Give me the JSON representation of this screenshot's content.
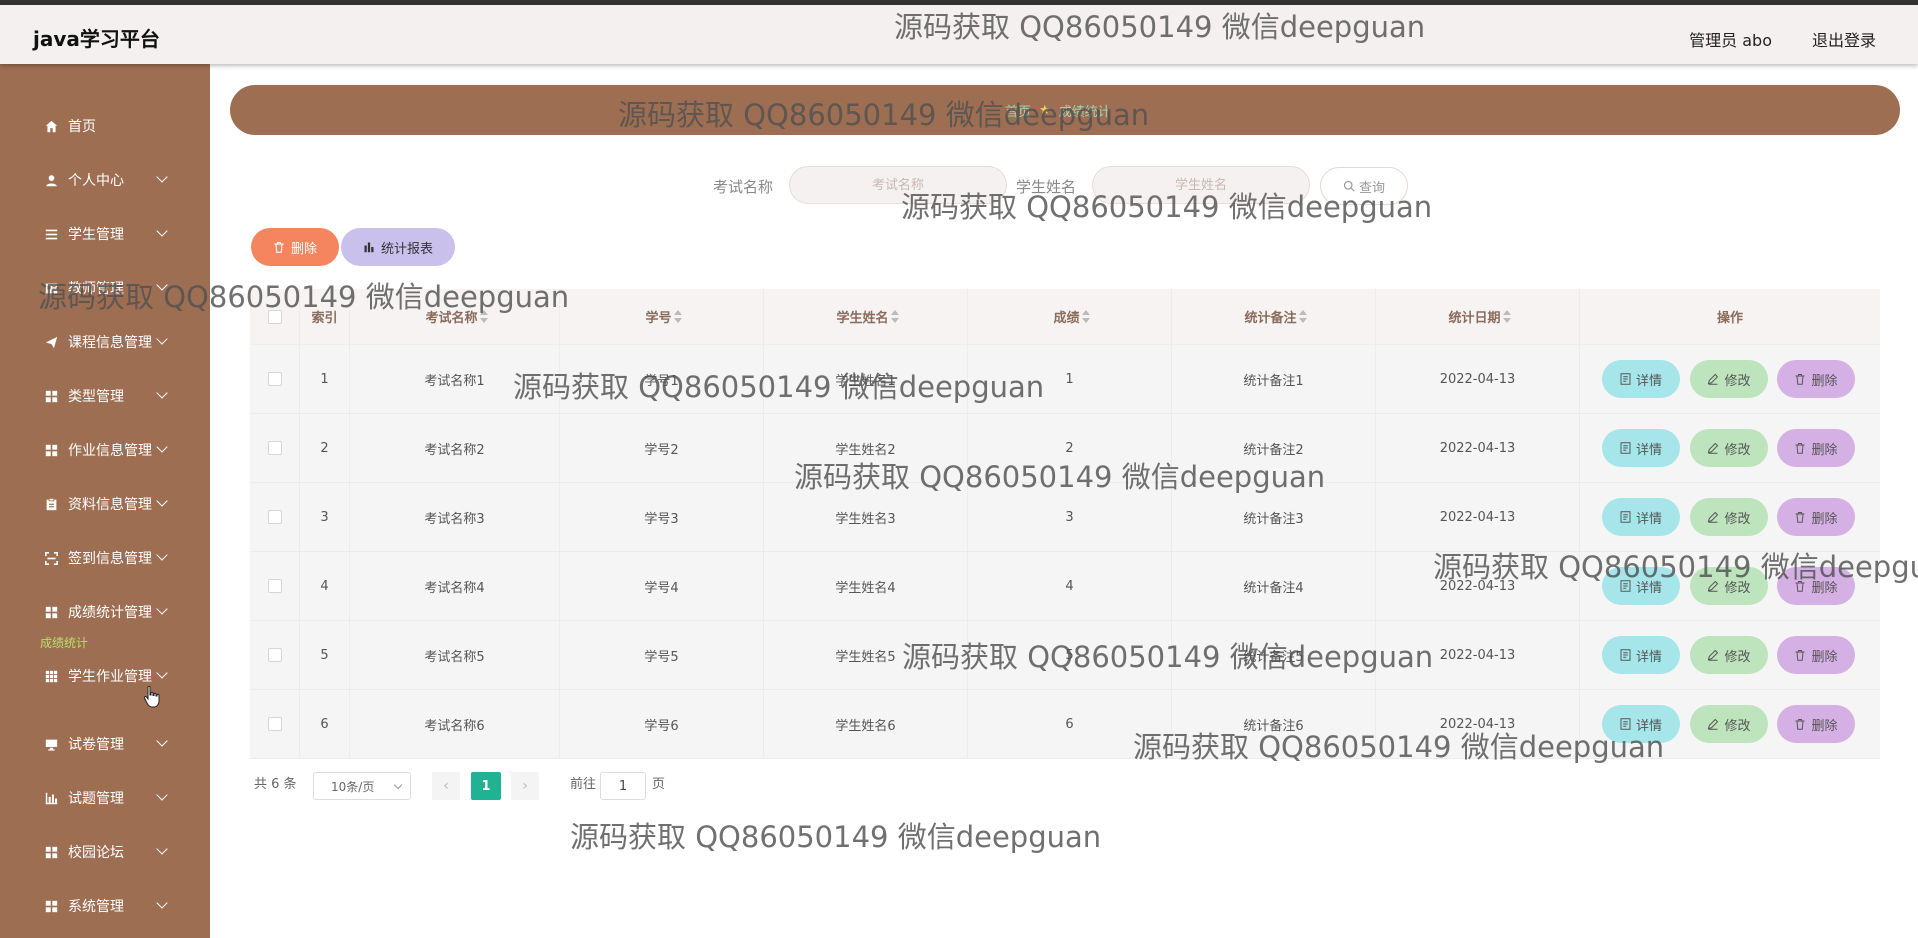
{
  "header": {
    "brand": "java学习平台",
    "user": "管理员 abo",
    "logout": "退出登录"
  },
  "sidebar": {
    "items": [
      {
        "label": "首页",
        "icon": "home-icon"
      },
      {
        "label": "个人中心",
        "icon": "user-icon"
      },
      {
        "label": "学生管理",
        "icon": "list-icon"
      },
      {
        "label": "教师管理",
        "icon": "id-card-icon"
      },
      {
        "label": "课程信息管理",
        "icon": "send-icon"
      },
      {
        "label": "类型管理",
        "icon": "grid-icon"
      },
      {
        "label": "作业信息管理",
        "icon": "grid-icon"
      },
      {
        "label": "资料信息管理",
        "icon": "clipboard-icon"
      },
      {
        "label": "签到信息管理",
        "icon": "scan-icon"
      },
      {
        "label": "成绩统计管理",
        "icon": "grid-icon"
      },
      {
        "label": "学生作业管理",
        "icon": "apps-icon"
      },
      {
        "label": "试卷管理",
        "icon": "monitor-icon"
      },
      {
        "label": "试题管理",
        "icon": "bar-chart-icon"
      },
      {
        "label": "校园论坛",
        "icon": "grid-icon"
      },
      {
        "label": "系统管理",
        "icon": "grid-icon"
      }
    ],
    "sub_label": "成绩统计"
  },
  "breadcrumb": {
    "home": "首页",
    "current": "成绩统计"
  },
  "search": {
    "exam_label": "考试名称",
    "exam_placeholder": "考试名称",
    "student_label": "学生姓名",
    "student_placeholder": "学生姓名",
    "query": "查询"
  },
  "toolbar": {
    "delete": "删除",
    "report": "统计报表"
  },
  "table": {
    "columns": [
      "索引",
      "考试名称",
      "学号",
      "学生姓名",
      "成绩",
      "统计备注",
      "统计日期",
      "操作"
    ],
    "rows": [
      [
        "1",
        "考试名称1",
        "学号1",
        "学生姓名1",
        "1",
        "统计备注1",
        "2022-04-13"
      ],
      [
        "2",
        "考试名称2",
        "学号2",
        "学生姓名2",
        "2",
        "统计备注2",
        "2022-04-13"
      ],
      [
        "3",
        "考试名称3",
        "学号3",
        "学生姓名3",
        "3",
        "统计备注3",
        "2022-04-13"
      ],
      [
        "4",
        "考试名称4",
        "学号4",
        "学生姓名4",
        "4",
        "统计备注4",
        "2022-04-13"
      ],
      [
        "5",
        "考试名称5",
        "学号5",
        "学生姓名5",
        "5",
        "统计备注5",
        "2022-04-13"
      ],
      [
        "6",
        "考试名称6",
        "学号6",
        "学生姓名6",
        "6",
        "统计备注6",
        "2022-04-13"
      ]
    ],
    "ops": {
      "detail": "详情",
      "edit": "修改",
      "delete": "删除"
    }
  },
  "pagination": {
    "total": "共 6 条",
    "page_size": "10条/页",
    "current_page": "1",
    "goto_prefix": "前往",
    "goto_value": "1",
    "goto_suffix": "页"
  },
  "watermark": "源码获取 QQ86050149 微信deepguan",
  "colors": {
    "sidebar": "#9e6e52",
    "banner": "#9e6e52",
    "active_page": "#1fb394",
    "delete_btn": "#f4855f",
    "report_btn": "#c9c1ec"
  }
}
